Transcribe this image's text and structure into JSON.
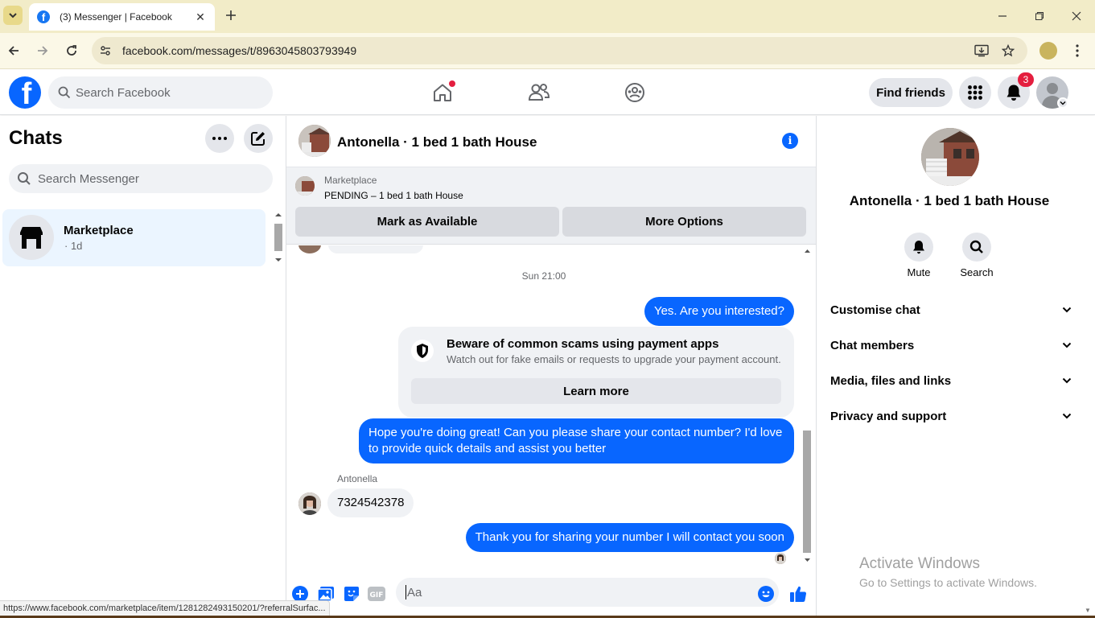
{
  "browser": {
    "tab_title": "(3) Messenger | Facebook",
    "url": "facebook.com/messages/t/8963045803793949",
    "status_url": "https://www.facebook.com/marketplace/item/1281282493150201/?referralSurfac..."
  },
  "fb_header": {
    "logo_letter": "f",
    "search_placeholder": "Search Facebook",
    "find_friends": "Find friends",
    "notification_count": "3",
    "nav_icons": [
      "home-icon",
      "friends-icon",
      "groups-icon"
    ]
  },
  "chats": {
    "title": "Chats",
    "search_placeholder": "Search Messenger",
    "items": [
      {
        "name": "Marketplace",
        "sub": "· 1d"
      }
    ]
  },
  "conversation": {
    "title": "Antonella · 1 bed 1 bath House",
    "marketplace": {
      "label": "Marketplace",
      "status": "PENDING – 1 bed 1 bath House",
      "mark_available": "Mark as Available",
      "more_options": "More Options"
    },
    "timestamp": "Sun 21:00",
    "messages": {
      "m1": "Yes. Are you interested?",
      "m2": "Hope you're doing great! Can you please share your contact number? I'd love to provide quick details and assist you better",
      "m3_sender": "Antonella",
      "m3": "7324542378",
      "m4": "Thank you for sharing your number I will contact you soon"
    },
    "scam_notice": {
      "title": "Beware of common scams using payment apps",
      "desc": "Watch out for fake emails or requests to upgrade your payment account.",
      "learn_more": "Learn more"
    },
    "composer_placeholder": "Aa"
  },
  "right_panel": {
    "name": "Antonella · 1 bed 1 bath House",
    "actions": {
      "mute": "Mute",
      "search": "Search"
    },
    "sections": {
      "customise": "Customise chat",
      "members": "Chat members",
      "media": "Media, files and links",
      "privacy": "Privacy and support"
    }
  },
  "os_watermark": {
    "line1": "Activate Windows",
    "line2": "Go to Settings to activate Windows."
  },
  "colors": {
    "brand": "#0866ff",
    "bubble_out": "#0866ff",
    "bubble_in": "#f0f2f5",
    "badge": "#e41e3f"
  }
}
